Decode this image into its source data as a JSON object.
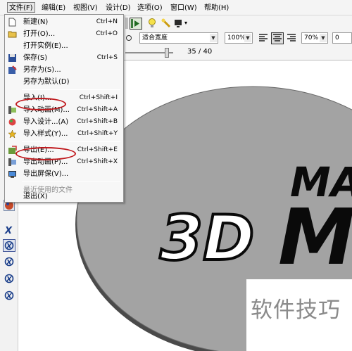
{
  "menubar": {
    "file": "文件(F)",
    "edit": "编辑(E)",
    "view": "视图(V)",
    "design": "设计(D)",
    "options": "选项(O)",
    "window": "窗口(W)",
    "help": "帮助(H)"
  },
  "file_menu": {
    "new": "新建(N)",
    "new_sc": "Ctrl+N",
    "open": "打开(O)...",
    "open_sc": "Ctrl+O",
    "open_example": "打开实例(E)...",
    "save": "保存(S)",
    "save_sc": "Ctrl+S",
    "save_as": "另存为(S)...",
    "save_as_default": "另存为默认(D)",
    "import": "导入(I)...",
    "import_sc": "Ctrl+Shift+I",
    "import_animation": "导入动画(M)...",
    "import_animation_sc": "Ctrl+Shift+A",
    "import_design": "导入设计...(A)",
    "import_design_sc": "Ctrl+Shift+B",
    "import_style": "导入样式(Y)...",
    "import_style_sc": "Ctrl+Shift+Y",
    "export": "导出(E)...",
    "export_sc": "Ctrl+Shift+E",
    "export_animation": "导出动画(P)...",
    "export_animation_sc": "Ctrl+Shift+X",
    "export_screensaver": "导出屏保(V)...",
    "recent_files": "最近使用的文件",
    "exit": "退出(X)"
  },
  "toolbar": {
    "fit_zoom": "适合宽度",
    "zoom_percent": "100%",
    "letter_spacing": "70%",
    "extra_value": "0",
    "frame_counter": "35 / 40"
  },
  "canvas": {
    "text_top": "MA",
    "text_3d": "3D",
    "text_m": "M"
  },
  "watermark": "软件技巧",
  "colors": {
    "disc_gray": "#a3a3a3",
    "highlight_red": "#c0181c",
    "menu_bg": "#f7f7f7"
  }
}
